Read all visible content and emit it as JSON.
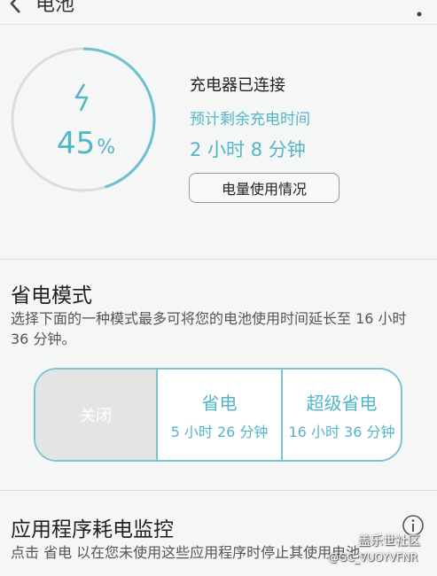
{
  "header": {
    "title": "电池"
  },
  "battery": {
    "level_percent": 45,
    "percent_number": "45",
    "percent_unit": "%",
    "status": "充电器已连接",
    "remaining_label": "预计剩余充电时间",
    "remaining_time": "2 小时 8 分钟",
    "usage_button_label": "电量使用情况",
    "accent_color": "#54b4c8"
  },
  "power_saving": {
    "title": "省电模式",
    "description": "选择下面的一种模式最多可将您的电池使用时间延长至 16 小时 36 分钟。",
    "modes": [
      {
        "name": "关闭",
        "time": ""
      },
      {
        "name": "省电",
        "time": "5 小时 26 分钟"
      },
      {
        "name": "超级省电",
        "time": "16 小时 36 分钟"
      }
    ],
    "selected_index": 0
  },
  "app_monitor": {
    "title": "应用程序耗电监控",
    "description": "点击 省电 以在您未使用这些应用程序时停止其使用电池。"
  },
  "watermark": {
    "line1": "盖乐世社区",
    "line2": "@GC_VUOYVFNR"
  }
}
